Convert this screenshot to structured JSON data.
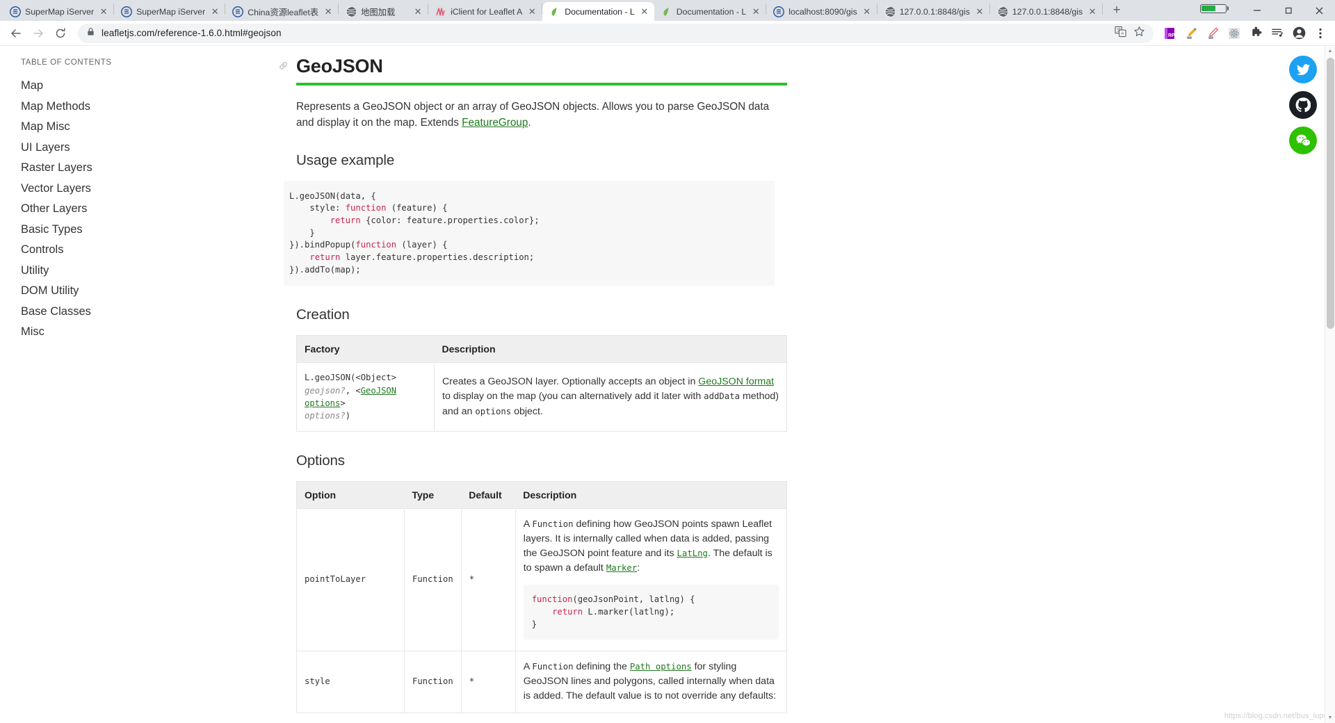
{
  "browser": {
    "tabs": [
      {
        "title": "SuperMap iServer",
        "favicon": "supermap-icon",
        "active": false
      },
      {
        "title": "SuperMap iServer",
        "favicon": "supermap-icon",
        "active": false
      },
      {
        "title": "China资源leaflet表",
        "favicon": "supermap-icon",
        "active": false
      },
      {
        "title": "地图加载",
        "favicon": "globe-icon",
        "active": false
      },
      {
        "title": "iClient for Leaflet A",
        "favicon": "iclient-icon",
        "active": false
      },
      {
        "title": "Documentation - L",
        "favicon": "leaflet-icon",
        "active": true
      },
      {
        "title": "Documentation - L",
        "favicon": "leaflet-icon",
        "active": false
      },
      {
        "title": "localhost:8090/gis",
        "favicon": "supermap-icon",
        "active": false
      },
      {
        "title": "127.0.0.1:8848/gis",
        "favicon": "globe-icon",
        "active": false
      },
      {
        "title": "127.0.0.1:8848/gis",
        "favicon": "globe-icon",
        "active": false
      }
    ],
    "new_tab_label": "+",
    "close_label": "✕",
    "window_controls": {
      "minimize": "—",
      "maximize": "❐",
      "close": "✕"
    },
    "toolbar": {
      "back": "back-arrow",
      "forward": "forward-arrow",
      "reload": "reload-arrow",
      "url": "leafletjs.com/reference-1.6.0.html#geojson",
      "lock": "lock-icon",
      "translate": "translate-icon",
      "bookmark": "star-icon",
      "extensions": [
        "rp-extension-icon",
        "highlighter-pen-icon",
        "red-pen-icon",
        "react-devtools-icon",
        "puzzle-extension-icon",
        "reading-list-icon"
      ],
      "profile": "profile-avatar-icon",
      "menu": "three-dot-menu-icon"
    }
  },
  "sidebar": {
    "heading": "TABLE OF CONTENTS",
    "items": [
      {
        "label": "Map"
      },
      {
        "label": "Map Methods"
      },
      {
        "label": "Map Misc"
      },
      {
        "label": "UI Layers"
      },
      {
        "label": "Raster Layers"
      },
      {
        "label": "Vector Layers"
      },
      {
        "label": "Other Layers"
      },
      {
        "label": "Basic Types"
      },
      {
        "label": "Controls"
      },
      {
        "label": "Utility"
      },
      {
        "label": "DOM Utility"
      },
      {
        "label": "Base Classes"
      },
      {
        "label": "Misc"
      }
    ]
  },
  "main": {
    "anchor": "🔗",
    "title": "GeoJSON",
    "intro_a": "Represents a GeoJSON object or an array of GeoJSON objects. Allows you to parse GeoJSON data and display it on the map. Extends ",
    "intro_link": "FeatureGroup",
    "intro_b": ".",
    "usage_heading": "Usage example",
    "usage_code_l1": "L.geoJSON(data, {",
    "usage_code_l2_a": "    style: ",
    "usage_code_l2_kw": "function",
    "usage_code_l2_b": " (feature) {",
    "usage_code_l3_a": "        ",
    "usage_code_l3_kw": "return",
    "usage_code_l3_b": " {color: feature.properties.color};",
    "usage_code_l4": "    }",
    "usage_code_l5_a": "}).bindPopup(",
    "usage_code_l5_kw": "function",
    "usage_code_l5_b": " (layer) {",
    "usage_code_l6_a": "    ",
    "usage_code_l6_kw": "return",
    "usage_code_l6_b": " layer.feature.properties.description;",
    "usage_code_l7": "}).addTo(map);",
    "creation_heading": "Creation",
    "creation_table": {
      "headers": [
        "Factory",
        "Description"
      ],
      "row": {
        "factory_l1": "L.geoJSON(<Object>",
        "factory_l2_opt": "geojson?",
        "factory_l2_mid": ", <",
        "factory_l2_link": "GeoJSON options",
        "factory_l2_end": ">",
        "factory_l3_opt": "options?",
        "factory_l3_end": ")",
        "desc_a": "Creates a GeoJSON layer. Optionally accepts an object in ",
        "desc_link": "GeoJSON format",
        "desc_b": " to display on the map (you can alternatively add it later with ",
        "desc_code1": "addData",
        "desc_c": " method) and an ",
        "desc_code2": "options",
        "desc_d": " object."
      }
    },
    "options_heading": "Options",
    "options_table": {
      "headers": [
        "Option",
        "Type",
        "Default",
        "Description"
      ],
      "rows": [
        {
          "option": "pointToLayer",
          "type": "Function",
          "default": "*",
          "desc_a": "A ",
          "desc_code1": "Function",
          "desc_b": " defining how GeoJSON points spawn Leaflet layers. It is internally called when data is added, passing the GeoJSON point feature and its ",
          "desc_link1": "LatLng",
          "desc_c": ". The default is to spawn a default ",
          "desc_link2": "Marker",
          "desc_d": ":",
          "code_l1_kw": "function",
          "code_l1_rest": "(geoJsonPoint, latlng) {",
          "code_l2_a": "    ",
          "code_l2_kw": "return",
          "code_l2_b": " L.marker(latlng);",
          "code_l3": "}"
        },
        {
          "option": "style",
          "type": "Function",
          "default": "*",
          "desc_a": "A ",
          "desc_code1": "Function",
          "desc_b": " defining the ",
          "desc_link1": "Path options",
          "desc_c": " for styling GeoJSON lines and polygons, called internally when data is added. The default value is to not override any defaults:",
          "code_l1_kw": "",
          "code_l1_rest": "",
          "code_l2_a": "",
          "code_l2_kw": "",
          "code_l2_b": "",
          "code_l3": ""
        }
      ]
    }
  },
  "social": [
    {
      "name": "twitter",
      "color": "#1da1f2"
    },
    {
      "name": "github",
      "color": "#1b1f23"
    },
    {
      "name": "wechat",
      "color": "#2dc100"
    }
  ],
  "watermark": "https://blog.csdn.net/bus_lupu",
  "scrollbar": {
    "up": "▲",
    "down": "▼"
  }
}
